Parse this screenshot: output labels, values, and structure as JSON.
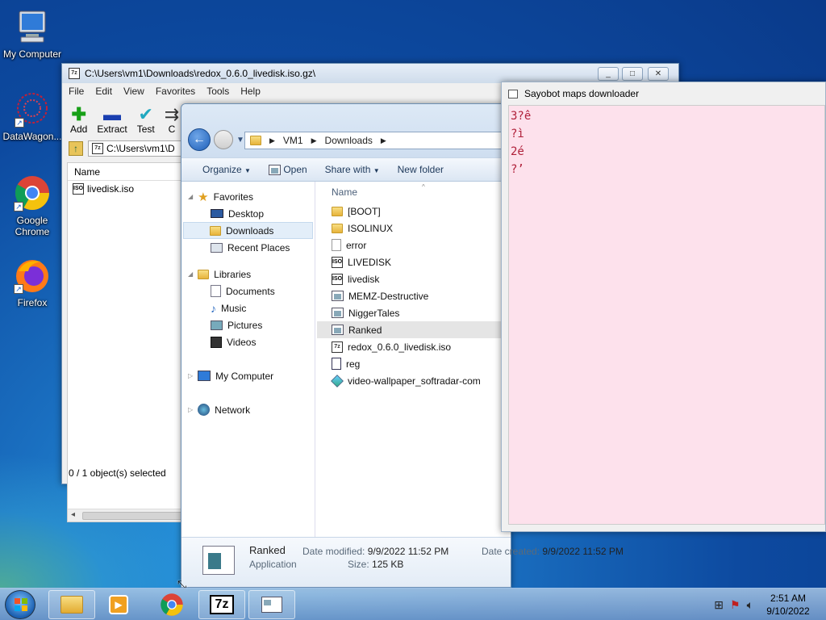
{
  "desktop": {
    "icons": [
      {
        "label": "My Computer"
      },
      {
        "label": "DataWagon..."
      },
      {
        "label": "Google Chrome"
      },
      {
        "label": "Firefox"
      }
    ]
  },
  "sevenzip": {
    "title": "C:\\Users\\vm1\\Downloads\\redox_0.6.0_livedisk.iso.gz\\",
    "menu": [
      "File",
      "Edit",
      "View",
      "Favorites",
      "Tools",
      "Help"
    ],
    "toolbar": {
      "add": "Add",
      "extract": "Extract",
      "test": "Test",
      "copy": "C"
    },
    "address": "C:\\Users\\vm1\\D",
    "column_name": "Name",
    "files": [
      {
        "name": "livedisk.iso"
      }
    ],
    "status": "0 / 1 object(s) selected"
  },
  "explorer": {
    "breadcrumb": [
      "VM1",
      "Downloads"
    ],
    "commands": {
      "organize": "Organize",
      "open": "Open",
      "share": "Share with",
      "new_folder": "New folder"
    },
    "nav": {
      "favorites": "Favorites",
      "desktop": "Desktop",
      "downloads": "Downloads",
      "recent": "Recent Places",
      "libraries": "Libraries",
      "documents": "Documents",
      "music": "Music",
      "pictures": "Pictures",
      "videos": "Videos",
      "computer": "My Computer",
      "network": "Network"
    },
    "column_name": "Name",
    "files": [
      {
        "name": "[BOOT]",
        "icon": "folder-icon"
      },
      {
        "name": "ISOLINUX",
        "icon": "folder-icon"
      },
      {
        "name": "error",
        "icon": "file-icon"
      },
      {
        "name": "LIVEDISK",
        "icon": "iso-icon"
      },
      {
        "name": "livedisk",
        "icon": "iso-icon"
      },
      {
        "name": "MEMZ-Destructive",
        "icon": "app-icon"
      },
      {
        "name": "NiggerTales",
        "icon": "app-icon"
      },
      {
        "name": "Ranked",
        "icon": "app-icon"
      },
      {
        "name": "redox_0.6.0_livedisk.iso",
        "icon": "7z-icon"
      },
      {
        "name": "reg",
        "icon": "reg-icon"
      },
      {
        "name": "video-wallpaper_softradar-com",
        "icon": "installer-icon"
      }
    ],
    "details": {
      "name": "Ranked",
      "type": "Application",
      "modified_label": "Date modified:",
      "modified": "9/9/2022 11:52 PM",
      "created_label": "Date created:",
      "created": "9/9/2022 11:52 PM",
      "size_label": "Size:",
      "size": "125 KB"
    }
  },
  "sayobot": {
    "title": "Sayobot maps downloader",
    "lines": [
      "3?ê",
      "?ì",
      "2é",
      "?’"
    ]
  },
  "taskbar": {
    "time": "2:51 AM",
    "date": "9/10/2022"
  }
}
